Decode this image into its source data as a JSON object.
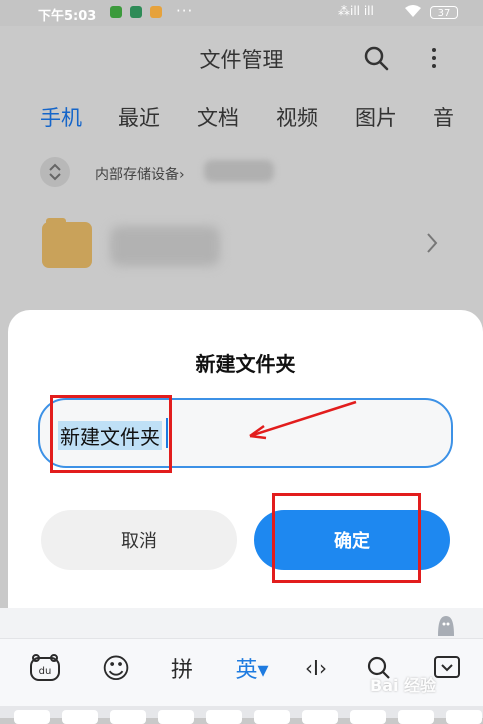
{
  "status_bar": {
    "time": "下午5:03",
    "dots": "···",
    "signal": "⁂ill ill",
    "battery": "37"
  },
  "app": {
    "title": "文件管理",
    "tabs": [
      "手机",
      "最近",
      "文档",
      "视频",
      "图片",
      "音"
    ],
    "active_tab": "手机",
    "breadcrumb": "内部存储设备",
    "breadcrumb_sep": "›",
    "row_chevron": "›",
    "colors": {
      "accent": "#1565c9",
      "folder": "#c9a25a"
    }
  },
  "dialog": {
    "title": "新建文件夹",
    "input_value": "新建文件夹",
    "cancel_label": "取消",
    "confirm_label": "确定",
    "colors": {
      "confirm": "#1e88f0",
      "input_border": "#3c91e6",
      "annotation": "#e21d1d"
    }
  },
  "keyboard": {
    "tools": [
      {
        "name": "keyboard-bear-icon",
        "label": "du"
      },
      {
        "name": "emoji-icon",
        "label": "☺"
      },
      {
        "name": "pinyin-toggle",
        "label": "拼"
      },
      {
        "name": "english-toggle",
        "label": "英▾"
      },
      {
        "name": "cursor-icon",
        "label": "‹I›"
      },
      {
        "name": "search-icon",
        "label": ""
      },
      {
        "name": "collapse-keyboard-icon",
        "label": ""
      }
    ]
  },
  "watermark": "Bai 经验"
}
